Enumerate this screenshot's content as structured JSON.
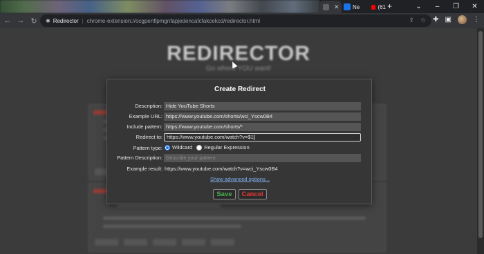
{
  "browser": {
    "tabs": [
      {
        "label": "",
        "favicon_color": "#5f6368"
      },
      {
        "label": "Ne",
        "favicon_color": "#1a73e8"
      },
      {
        "label": "(61",
        "favicon_color": "#ff0000"
      }
    ],
    "address": {
      "extension_name": "Redirector",
      "url": "chrome-extension://ocgpenflpmgnfapjedencafcfakcekcd/redirector.html"
    }
  },
  "page": {
    "title": "REDIRECTOR",
    "subtitle": "Go where YOU want!"
  },
  "dialog": {
    "title": "Create Redirect",
    "fields": {
      "description": {
        "label": "Description:",
        "value": "Hide YouTube Shorts"
      },
      "example_url": {
        "label": "Example URL:",
        "value": "https://www.youtube.com/shorts/wci_Yscw0B4"
      },
      "include_pattern": {
        "label": "Include pattern:",
        "value": "https://www.youtube.com/shorts/*"
      },
      "redirect_to": {
        "label": "Redirect to:",
        "value": "https://www.youtube.com/watch?v=$1"
      },
      "pattern_type": {
        "label": "Pattern type:",
        "options": [
          "Wildcard",
          "Regular Expression"
        ],
        "selected": "Wildcard"
      },
      "pattern_description": {
        "label": "Pattern Description:",
        "placeholder": "Describe your pattern"
      },
      "example_result": {
        "label": "Example result:",
        "value": "https://www.youtube.com/watch?v=wci_Yscw0B4"
      }
    },
    "advanced_link": "Show advanced options...",
    "save_label": "Save",
    "cancel_label": "Cancel"
  }
}
